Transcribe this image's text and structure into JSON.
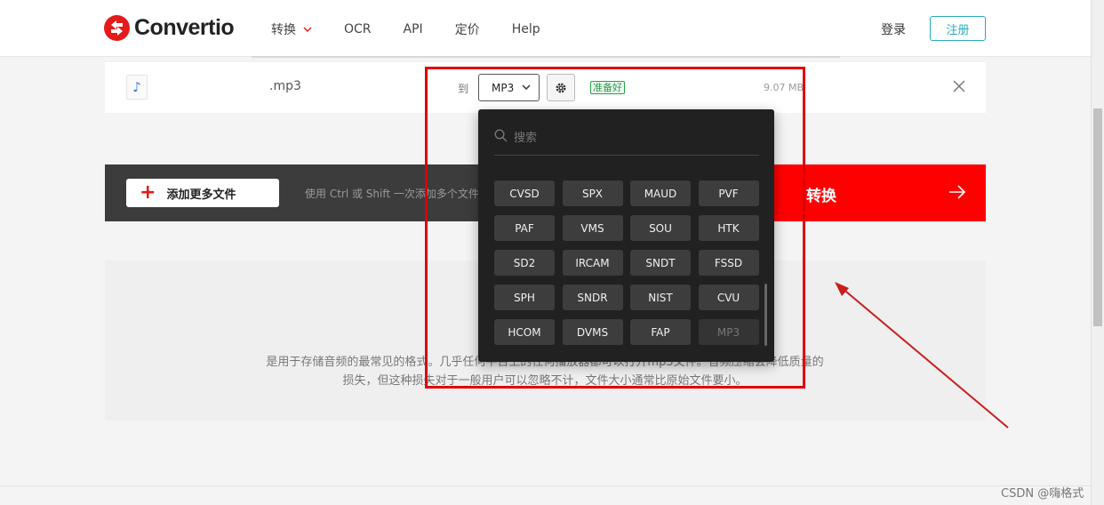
{
  "brand": {
    "name": "Convertio",
    "accent": "#e31b1b"
  },
  "nav": {
    "items": [
      {
        "label": "转换"
      },
      {
        "label": "OCR"
      },
      {
        "label": "API"
      },
      {
        "label": "定价"
      },
      {
        "label": "Help"
      }
    ],
    "login_label": "登录",
    "signup_label": "注册"
  },
  "file": {
    "name": ".mp3",
    "to_label": "到",
    "selected_format": "MP3",
    "status": "准备好",
    "size": "9.07 MB"
  },
  "actions": {
    "add_more_label": "添加更多文件",
    "hint": "使用 Ctrl 或 Shift 一次添加多个文件",
    "convert_label": "转换"
  },
  "info": {
    "text": "是用于存储音频的最常见的格式。几乎任何平台上的任何播放器都可以打开mp3文件。音频压缩会降低质量的损失，但这种损失对于一般用户可以忽略不计，文件大小通常比原始文件要小。"
  },
  "dropdown": {
    "search_placeholder": "搜索",
    "formats": [
      "CVSD",
      "SPX",
      "MAUD",
      "PVF",
      "PAF",
      "VMS",
      "SOU",
      "HTK",
      "SD2",
      "IRCAM",
      "SNDT",
      "FSSD",
      "SPH",
      "SNDR",
      "NIST",
      "CVU",
      "HCOM",
      "DVMS",
      "FAP",
      "MP3"
    ],
    "disabled_format": "MP3"
  },
  "watermark": "CSDN @嗨格式"
}
